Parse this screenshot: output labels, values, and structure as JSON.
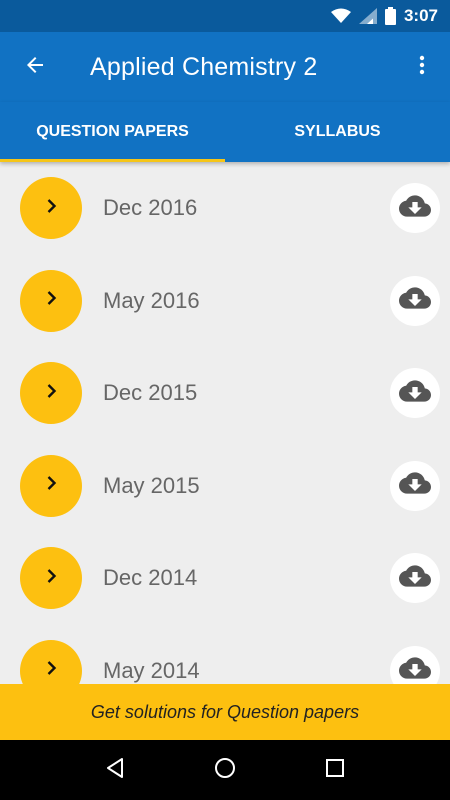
{
  "status_bar": {
    "time": "3:07",
    "icons": [
      "wifi-icon",
      "signal-icon",
      "battery-icon"
    ]
  },
  "app_bar": {
    "title": "Applied Chemistry 2",
    "back_icon": "arrow-back-icon",
    "menu_icon": "more-vert-icon"
  },
  "tabs": [
    {
      "label": "QUESTION PAPERS",
      "active": true
    },
    {
      "label": "SYLLABUS",
      "active": false
    }
  ],
  "papers": [
    {
      "label": "Dec 2016"
    },
    {
      "label": "May 2016"
    },
    {
      "label": "Dec 2015"
    },
    {
      "label": "May 2015"
    },
    {
      "label": "Dec 2014"
    },
    {
      "label": "May 2014"
    }
  ],
  "banner": {
    "text": "Get solutions for Question papers"
  },
  "nav": [
    "back-triangle-icon",
    "home-circle-icon",
    "recents-square-icon"
  ],
  "colors": {
    "primary": "#1172c3",
    "primary_dark": "#0a5a9c",
    "accent": "#fdc010",
    "background": "#eeeeee"
  }
}
